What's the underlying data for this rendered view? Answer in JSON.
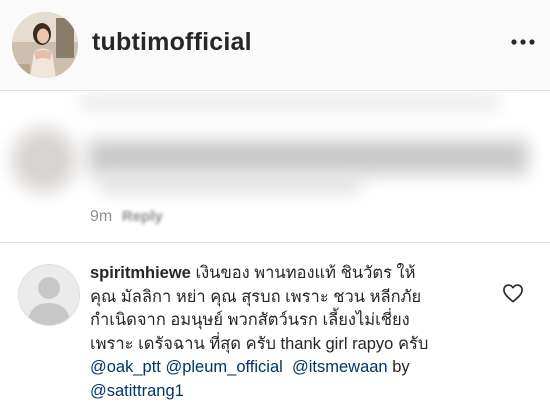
{
  "header": {
    "username": "tubtimofficial",
    "avatar_icon": "profile-photo",
    "more_icon": "more-options-icon"
  },
  "blurred_comment": {
    "time": "9m",
    "reply_label": "Reply"
  },
  "comment": {
    "username": "spiritmhiewe",
    "text_lines": [
      "เงินของ พานทองแท้ ชินวัตร ให้",
      "คุณ มัลลิกา หย่า คุณ สุรบถ เพราะ ชวน หลีกภัย",
      "กำเนิดจาก อมนุษย์ พวกสัตว์นรก เลี้ยงไม่เชี่ยง",
      "เพราะ เดรัจฉาน ที่สุด ครับ thank girl rapyo ครับ"
    ],
    "mentions": {
      "m1": "@oak_ptt",
      "m2": "@pleum_official",
      "m3": "@itsmewaan",
      "by": "by",
      "m4": "@satittrang1"
    },
    "like_icon": "heart-icon"
  },
  "colors": {
    "text": "#262626",
    "secondary": "#8e8e8e",
    "mention": "#003569",
    "header_bg": "#fafafa"
  }
}
